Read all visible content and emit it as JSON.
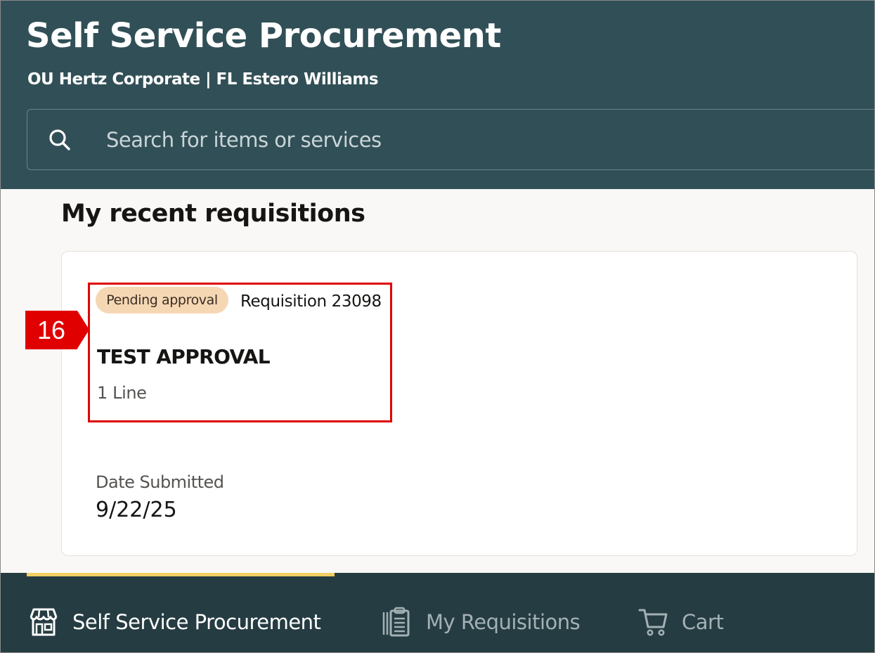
{
  "header": {
    "title": "Self Service Procurement",
    "subtitle": "OU Hertz Corporate | FL Estero Williams",
    "search": {
      "placeholder": "Search for items or services",
      "value": ""
    }
  },
  "main": {
    "section_title": "My recent requisitions",
    "requisition": {
      "status": "Pending approval",
      "number": "Requisition 23098",
      "title": "TEST APPROVAL",
      "lines": "1 Line",
      "date_label": "Date Submitted",
      "date_value": "9/22/25"
    }
  },
  "annotation": {
    "step_number": "16",
    "color": "#e00000"
  },
  "bottom_nav": {
    "items": [
      {
        "label": "Self Service Procurement",
        "icon": "storefront-icon",
        "active": true
      },
      {
        "label": "My Requisitions",
        "icon": "clipboard-list-icon",
        "active": false
      },
      {
        "label": "Cart",
        "icon": "cart-icon",
        "active": false
      }
    ]
  },
  "colors": {
    "header_bg": "#314f56",
    "nav_bg": "#253c42",
    "active_indicator": "#f3ce63",
    "badge_bg": "#f6d7b4",
    "page_bg": "#f9f8f6"
  }
}
